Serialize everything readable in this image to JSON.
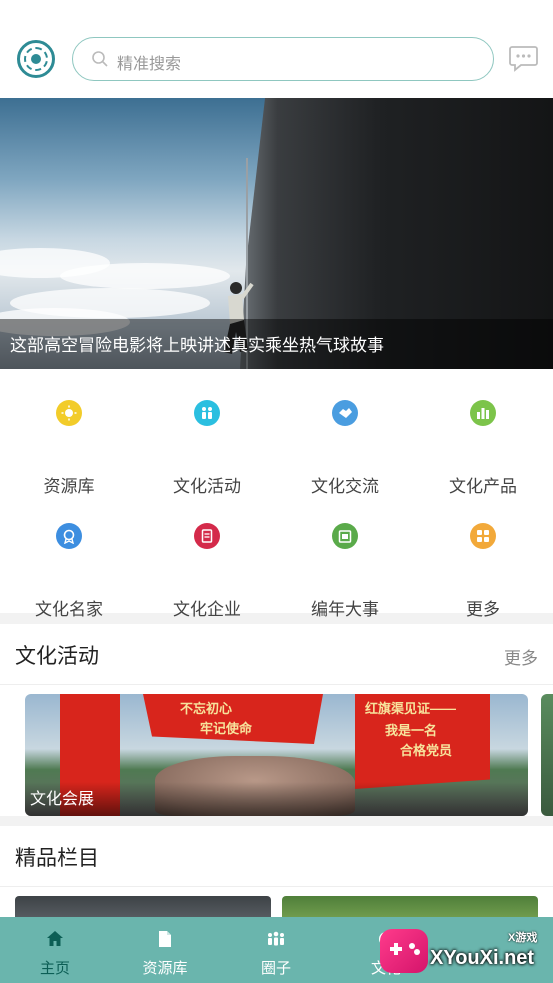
{
  "header": {
    "search_placeholder": "精准搜索",
    "logo_icon": "institution-seal-icon",
    "chat_icon": "chat-bubble-icon"
  },
  "banner": {
    "caption": "这部高空冒险电影将上映讲述真实乘坐热气球故事"
  },
  "categories": [
    {
      "label": "资源库",
      "icon": "sun-icon",
      "color": "#f2cc2a"
    },
    {
      "label": "文化活动",
      "icon": "people-icon",
      "color": "#2bbfe0"
    },
    {
      "label": "文化交流",
      "icon": "handshake-icon",
      "color": "#4a9de0"
    },
    {
      "label": "文化产品",
      "icon": "bar-chart-icon",
      "color": "#7cc44a"
    },
    {
      "label": "文化名家",
      "icon": "medal-icon",
      "color": "#3d8ee0"
    },
    {
      "label": "文化企业",
      "icon": "document-icon",
      "color": "#d42a4a"
    },
    {
      "label": "编年大事",
      "icon": "calendar-icon",
      "color": "#5aaa4a"
    },
    {
      "label": "更多",
      "icon": "grid-icon",
      "color": "#f2a93a"
    }
  ],
  "activities": {
    "title": "文化活动",
    "more": "更多",
    "card_caption": "文化会展",
    "flag_left": "不忘初心",
    "flag_left_2": "牢记使命",
    "flag_right": "红旗渠见证——",
    "flag_right_2": "我是一名",
    "flag_right_3": "合格党员"
  },
  "premium": {
    "title": "精品栏目"
  },
  "tabbar": {
    "items": [
      {
        "label": "主页",
        "icon": "home-icon",
        "active": true
      },
      {
        "label": "资源库",
        "icon": "file-icon",
        "active": false
      },
      {
        "label": "圈子",
        "icon": "group-icon",
        "active": false
      },
      {
        "label": "文化",
        "icon": "culture-icon",
        "active": false
      }
    ]
  },
  "watermark": {
    "text": "XYouXi.net",
    "small": "X游戏"
  }
}
